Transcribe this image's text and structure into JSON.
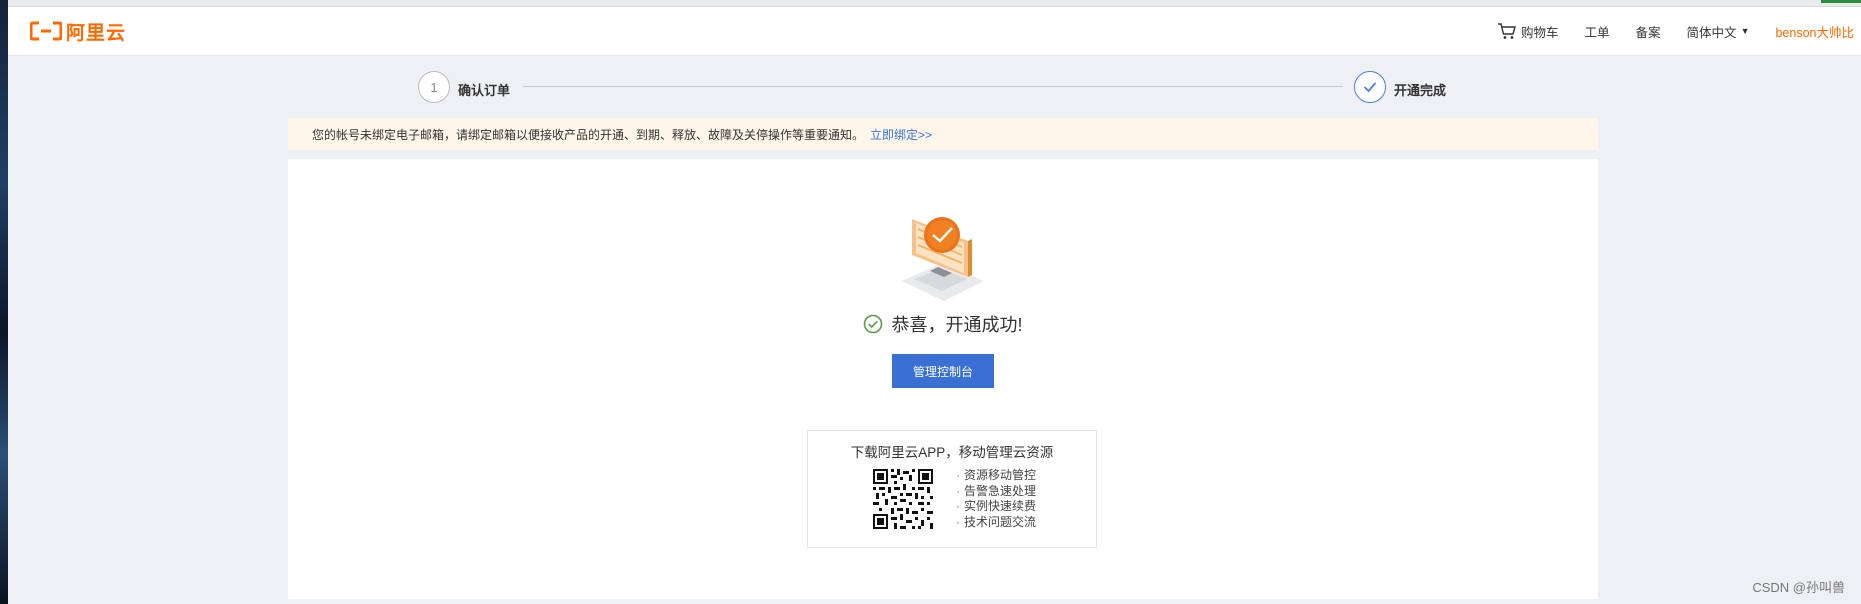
{
  "header": {
    "logo_text": "阿里云",
    "nav": {
      "cart": "购物车",
      "ticket": "工单",
      "filing": "备案",
      "language": "简体中文",
      "user": "benson大帅比"
    }
  },
  "steps": [
    {
      "index": "1",
      "label": "确认订单",
      "status": "pending"
    },
    {
      "label": "开通完成",
      "status": "done"
    }
  ],
  "notice": {
    "text": "您的帐号未绑定电子邮箱，请绑定邮箱以便接收产品的开通、到期、释放、故障及关停操作等重要通知。",
    "link": "立即绑定>>"
  },
  "result": {
    "message": "恭喜，开通成功!",
    "console_button": "管理控制台"
  },
  "app_promo": {
    "title": "下载阿里云APP，移动管理云资源",
    "features": [
      "资源移动管控",
      "告警急速处理",
      "实例快速续费",
      "技术问题交流"
    ]
  },
  "watermark": "CSDN @孙叫兽",
  "colors": {
    "brand": "#ff6a00",
    "primary": "#3a6fd3",
    "link": "#3a74d6",
    "notice_bg": "#fdf6e9",
    "success": "#5a9a46"
  }
}
